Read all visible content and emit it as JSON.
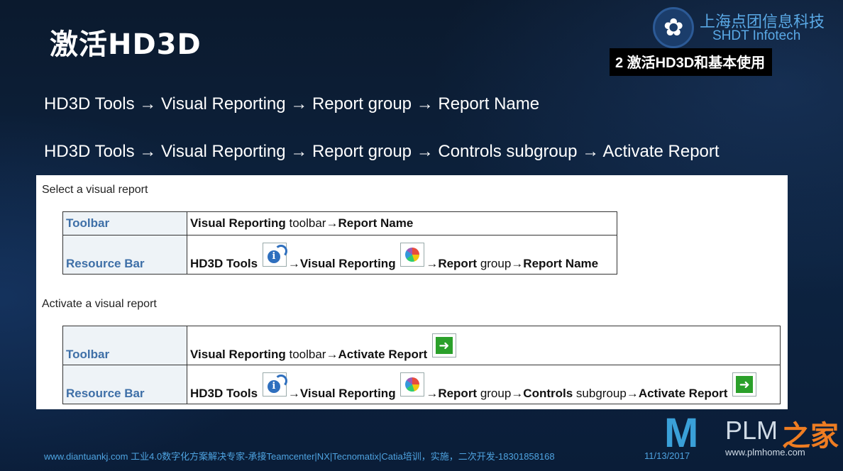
{
  "title": "激活HD3D",
  "logo": {
    "cn": "上海点团信息科技",
    "en": "SHDT Infotech"
  },
  "section_tag": "2 激活HD3D和基本使用",
  "paths": [
    "HD3D Tools → Visual Reporting → Report group → Report Name",
    "HD3D Tools → Visual Reporting → Report group → Controls subgroup → Activate Report"
  ],
  "panel": {
    "select_heading": "Select a visual report",
    "activate_heading": "Activate a visual report",
    "select_rows": {
      "toolbar_label": "Toolbar",
      "toolbar_vr": "Visual Reporting",
      "toolbar_tb": " toolbar→",
      "toolbar_rn": "Report Name",
      "rb_label": "Resource Bar",
      "rb_hd3d": "HD3D Tools",
      "rb_vr": "→Visual Reporting",
      "rb_rep": "→Report",
      "rb_group": " group→",
      "rb_rn": "Report Name"
    },
    "activate_rows": {
      "toolbar_label": "Toolbar",
      "toolbar_vr": "Visual Reporting",
      "toolbar_tb": " toolbar→",
      "toolbar_ar": "Activate Report",
      "rb_label": "Resource Bar",
      "rb_hd3d": "HD3D Tools",
      "rb_vr": "→Visual Reporting",
      "rb_rep": "→Report",
      "rb_group": " group→",
      "rb_controls": "Controls",
      "rb_sub": " subgroup→",
      "rb_ar": "Activate Report"
    },
    "icons": [
      "hd3d-tools-icon",
      "visual-reporting-icon",
      "activate-report-icon"
    ]
  },
  "footer": {
    "text": "www.diantuankj.com 工业4.0数字化方案解决专家-承接Teamcenter|NX|Tecnomatix|Catia培训，实施，二次开发-18301858168",
    "date": "11/13/2017"
  },
  "plm_logo": {
    "text": "PLM",
    "cn": "之家",
    "url": "www.plmhome.com"
  },
  "colors": {
    "background": "#0d2340",
    "label": "#3e6fa7",
    "footer": "#4ea3e0",
    "accent_green": "#2aa02a"
  }
}
